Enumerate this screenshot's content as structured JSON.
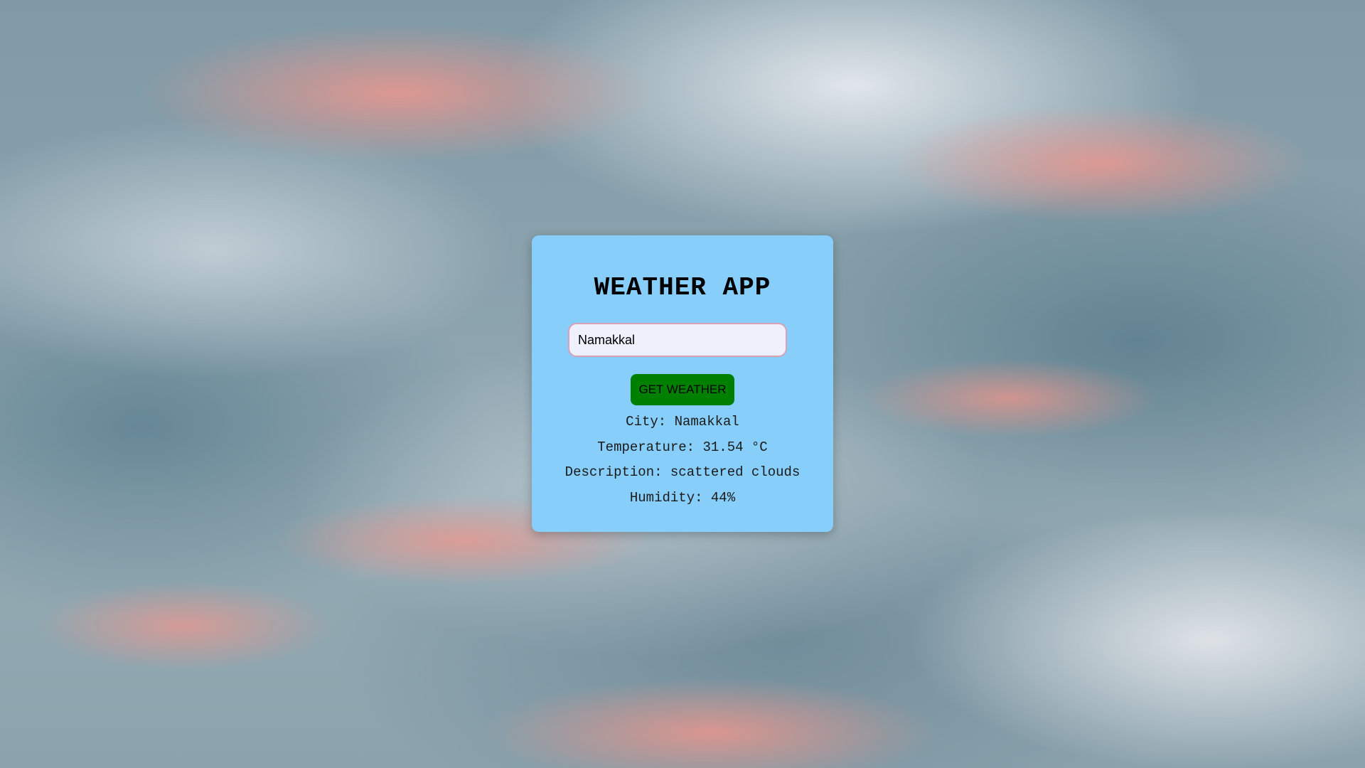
{
  "app": {
    "title": "WEATHER APP"
  },
  "search": {
    "value": "Namakkal",
    "button_label": "GET WEATHER"
  },
  "results": {
    "city": "City: Namakkal",
    "temperature": "Temperature: 31.54 °C",
    "description": "Description: scattered clouds",
    "humidity": "Humidity: 44%"
  },
  "colors": {
    "card_background": "#87cefa",
    "button_background": "#008000",
    "input_background": "#eef0fb",
    "input_border": "#d9a1b5"
  }
}
